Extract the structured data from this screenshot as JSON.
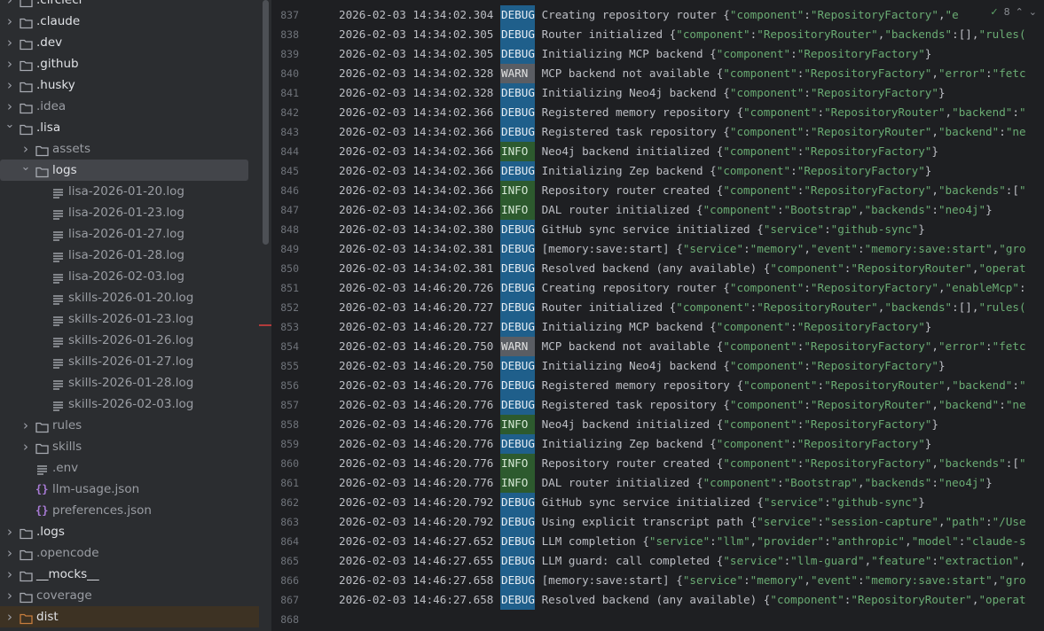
{
  "tree": [
    {
      "label": ".circleci",
      "type": "folder",
      "depth": 0,
      "expanded": false
    },
    {
      "label": ".claude",
      "type": "folder",
      "depth": 0,
      "expanded": false
    },
    {
      "label": ".dev",
      "type": "folder",
      "depth": 0,
      "expanded": false
    },
    {
      "label": ".github",
      "type": "folder-git",
      "depth": 0,
      "expanded": false
    },
    {
      "label": ".husky",
      "type": "folder",
      "depth": 0,
      "expanded": false
    },
    {
      "label": ".idea",
      "type": "folder",
      "depth": 0,
      "expanded": false,
      "dim": true
    },
    {
      "label": ".lisa",
      "type": "folder",
      "depth": 0,
      "expanded": true
    },
    {
      "label": "assets",
      "type": "folder",
      "depth": 1,
      "expanded": false,
      "dim": true
    },
    {
      "label": "logs",
      "type": "folder",
      "depth": 1,
      "expanded": true,
      "selected": true
    },
    {
      "label": "lisa-2026-01-20.log",
      "type": "file",
      "depth": 2,
      "dim": true
    },
    {
      "label": "lisa-2026-01-23.log",
      "type": "file",
      "depth": 2,
      "dim": true
    },
    {
      "label": "lisa-2026-01-27.log",
      "type": "file",
      "depth": 2,
      "dim": true
    },
    {
      "label": "lisa-2026-01-28.log",
      "type": "file",
      "depth": 2,
      "dim": true
    },
    {
      "label": "lisa-2026-02-03.log",
      "type": "file",
      "depth": 2,
      "dim": true
    },
    {
      "label": "skills-2026-01-20.log",
      "type": "file",
      "depth": 2,
      "dim": true
    },
    {
      "label": "skills-2026-01-23.log",
      "type": "file",
      "depth": 2,
      "dim": true
    },
    {
      "label": "skills-2026-01-26.log",
      "type": "file",
      "depth": 2,
      "dim": true
    },
    {
      "label": "skills-2026-01-27.log",
      "type": "file",
      "depth": 2,
      "dim": true
    },
    {
      "label": "skills-2026-01-28.log",
      "type": "file",
      "depth": 2,
      "dim": true
    },
    {
      "label": "skills-2026-02-03.log",
      "type": "file",
      "depth": 2,
      "dim": true
    },
    {
      "label": "rules",
      "type": "folder",
      "depth": 1,
      "expanded": false,
      "dim": true
    },
    {
      "label": "skills",
      "type": "folder",
      "depth": 1,
      "expanded": false,
      "dim": true
    },
    {
      "label": ".env",
      "type": "file",
      "depth": 1,
      "dim": true
    },
    {
      "label": "llm-usage.json",
      "type": "json",
      "depth": 1,
      "dim": true
    },
    {
      "label": "preferences.json",
      "type": "json",
      "depth": 1,
      "dim": true
    },
    {
      "label": ".logs",
      "type": "folder",
      "depth": 0,
      "expanded": false
    },
    {
      "label": ".opencode",
      "type": "folder",
      "depth": 0,
      "expanded": false,
      "dim": true
    },
    {
      "label": "__mocks__",
      "type": "folder",
      "depth": 0,
      "expanded": false
    },
    {
      "label": "coverage",
      "type": "folder",
      "depth": 0,
      "expanded": false,
      "dim": true
    },
    {
      "label": "dist",
      "type": "folder-orange",
      "depth": 0,
      "expanded": false,
      "dist": true
    }
  ],
  "inspection": {
    "count": "8"
  },
  "log_lines": [
    {
      "n": "837",
      "ts": "2026-02-03 14:34:02.304",
      "level": "DEBUG",
      "msg": "Creating repository router ",
      "json": "{\"component\":\"RepositoryFactory\",\"e"
    },
    {
      "n": "838",
      "ts": "2026-02-03 14:34:02.305",
      "level": "DEBUG",
      "msg": "Router initialized ",
      "json": "{\"component\":\"RepositoryRouter\",\"backends\":[],\"rules("
    },
    {
      "n": "839",
      "ts": "2026-02-03 14:34:02.305",
      "level": "DEBUG",
      "msg": "Initializing MCP backend ",
      "json": "{\"component\":\"RepositoryFactory\"}"
    },
    {
      "n": "840",
      "ts": "2026-02-03 14:34:02.328",
      "level": "WARN",
      "msg": "MCP backend not available ",
      "json": "{\"component\":\"RepositoryFactory\",\"error\":\"fetc"
    },
    {
      "n": "841",
      "ts": "2026-02-03 14:34:02.328",
      "level": "DEBUG",
      "msg": "Initializing Neo4j backend ",
      "json": "{\"component\":\"RepositoryFactory\"}"
    },
    {
      "n": "842",
      "ts": "2026-02-03 14:34:02.366",
      "level": "DEBUG",
      "msg": "Registered memory repository ",
      "json": "{\"component\":\"RepositoryRouter\",\"backend\":\""
    },
    {
      "n": "843",
      "ts": "2026-02-03 14:34:02.366",
      "level": "DEBUG",
      "msg": "Registered task repository ",
      "json": "{\"component\":\"RepositoryRouter\",\"backend\":\"ne"
    },
    {
      "n": "844",
      "ts": "2026-02-03 14:34:02.366",
      "level": "INFO",
      "msg": "Neo4j backend initialized ",
      "json": "{\"component\":\"RepositoryFactory\"}"
    },
    {
      "n": "845",
      "ts": "2026-02-03 14:34:02.366",
      "level": "DEBUG",
      "msg": "Initializing Zep backend ",
      "json": "{\"component\":\"RepositoryFactory\"}"
    },
    {
      "n": "846",
      "ts": "2026-02-03 14:34:02.366",
      "level": "INFO",
      "msg": "Repository router created ",
      "json": "{\"component\":\"RepositoryFactory\",\"backends\":[\""
    },
    {
      "n": "847",
      "ts": "2026-02-03 14:34:02.366",
      "level": "INFO",
      "msg": "DAL router initialized ",
      "json": "{\"component\":\"Bootstrap\",\"backends\":\"neo4j\"}"
    },
    {
      "n": "848",
      "ts": "2026-02-03 14:34:02.380",
      "level": "DEBUG",
      "msg": "GitHub sync service initialized ",
      "json": "{\"service\":\"github-sync\"}"
    },
    {
      "n": "849",
      "ts": "2026-02-03 14:34:02.381",
      "level": "DEBUG",
      "msg": "[memory:save:start] ",
      "json": "{\"service\":\"memory\",\"event\":\"memory:save:start\",\"gro"
    },
    {
      "n": "850",
      "ts": "2026-02-03 14:34:02.381",
      "level": "DEBUG",
      "msg": "Resolved backend (any available) ",
      "json": "{\"component\":\"RepositoryRouter\",\"operat"
    },
    {
      "n": "851",
      "ts": "2026-02-03 14:46:20.726",
      "level": "DEBUG",
      "msg": "Creating repository router ",
      "json": "{\"component\":\"RepositoryFactory\",\"enableMcp\":"
    },
    {
      "n": "852",
      "ts": "2026-02-03 14:46:20.727",
      "level": "DEBUG",
      "msg": "Router initialized ",
      "json": "{\"component\":\"RepositoryRouter\",\"backends\":[],\"rules("
    },
    {
      "n": "853",
      "ts": "2026-02-03 14:46:20.727",
      "level": "DEBUG",
      "msg": "Initializing MCP backend ",
      "json": "{\"component\":\"RepositoryFactory\"}"
    },
    {
      "n": "854",
      "ts": "2026-02-03 14:46:20.750",
      "level": "WARN",
      "msg": "MCP backend not available ",
      "json": "{\"component\":\"RepositoryFactory\",\"error\":\"fetc"
    },
    {
      "n": "855",
      "ts": "2026-02-03 14:46:20.750",
      "level": "DEBUG",
      "msg": "Initializing Neo4j backend ",
      "json": "{\"component\":\"RepositoryFactory\"}"
    },
    {
      "n": "856",
      "ts": "2026-02-03 14:46:20.776",
      "level": "DEBUG",
      "msg": "Registered memory repository ",
      "json": "{\"component\":\"RepositoryRouter\",\"backend\":\""
    },
    {
      "n": "857",
      "ts": "2026-02-03 14:46:20.776",
      "level": "DEBUG",
      "msg": "Registered task repository ",
      "json": "{\"component\":\"RepositoryRouter\",\"backend\":\"ne"
    },
    {
      "n": "858",
      "ts": "2026-02-03 14:46:20.776",
      "level": "INFO",
      "msg": "Neo4j backend initialized ",
      "json": "{\"component\":\"RepositoryFactory\"}"
    },
    {
      "n": "859",
      "ts": "2026-02-03 14:46:20.776",
      "level": "DEBUG",
      "msg": "Initializing Zep backend ",
      "json": "{\"component\":\"RepositoryFactory\"}"
    },
    {
      "n": "860",
      "ts": "2026-02-03 14:46:20.776",
      "level": "INFO",
      "msg": "Repository router created ",
      "json": "{\"component\":\"RepositoryFactory\",\"backends\":[\""
    },
    {
      "n": "861",
      "ts": "2026-02-03 14:46:20.776",
      "level": "INFO",
      "msg": "DAL router initialized ",
      "json": "{\"component\":\"Bootstrap\",\"backends\":\"neo4j\"}"
    },
    {
      "n": "862",
      "ts": "2026-02-03 14:46:20.792",
      "level": "DEBUG",
      "msg": "GitHub sync service initialized ",
      "json": "{\"service\":\"github-sync\"}"
    },
    {
      "n": "863",
      "ts": "2026-02-03 14:46:20.792",
      "level": "DEBUG",
      "msg": "Using explicit transcript path ",
      "json": "{\"service\":\"session-capture\",\"path\":\"/Use"
    },
    {
      "n": "864",
      "ts": "2026-02-03 14:46:27.652",
      "level": "DEBUG",
      "msg": "LLM completion ",
      "json": "{\"service\":\"llm\",\"provider\":\"anthropic\",\"model\":\"claude-s"
    },
    {
      "n": "865",
      "ts": "2026-02-03 14:46:27.655",
      "level": "DEBUG",
      "msg": "LLM guard: call completed ",
      "json": "{\"service\":\"llm-guard\",\"feature\":\"extraction\","
    },
    {
      "n": "866",
      "ts": "2026-02-03 14:46:27.658",
      "level": "DEBUG",
      "msg": "[memory:save:start] ",
      "json": "{\"service\":\"memory\",\"event\":\"memory:save:start\",\"gro"
    },
    {
      "n": "867",
      "ts": "2026-02-03 14:46:27.658",
      "level": "DEBUG",
      "msg": "Resolved backend (any available) ",
      "json": "{\"component\":\"RepositoryRouter\",\"operat"
    },
    {
      "n": "868",
      "ts": "",
      "level": "",
      "msg": "",
      "json": ""
    }
  ]
}
